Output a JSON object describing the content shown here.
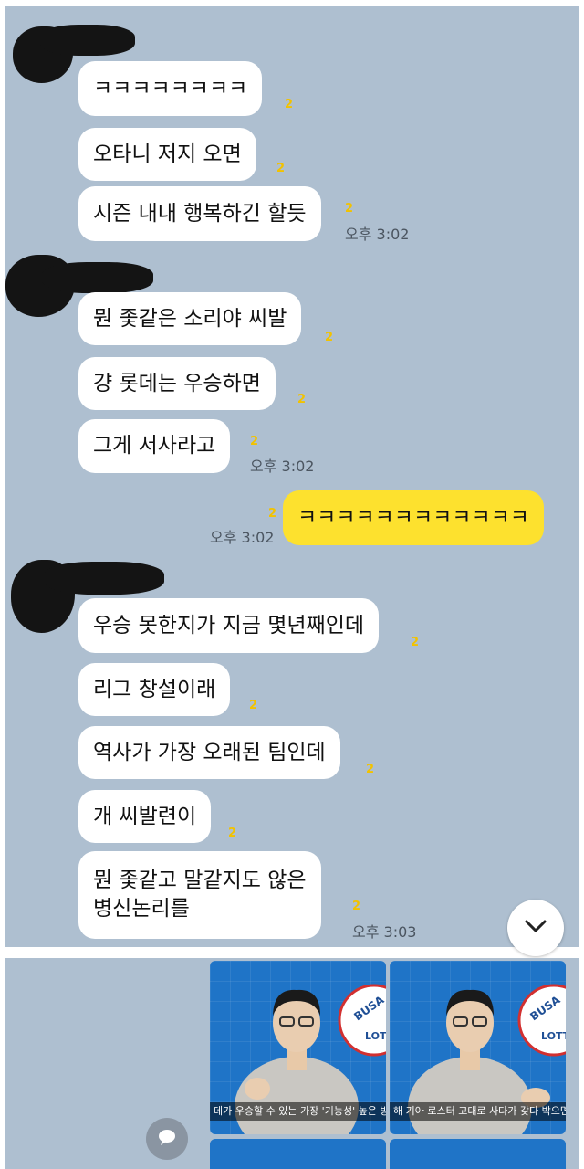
{
  "messages": [
    {
      "text": "ㅋㅋㅋㅋㅋㅋㅋㅋ",
      "unread": "2"
    },
    {
      "text": "오타니 저지 오면",
      "unread": "2"
    },
    {
      "text": "시즌 내내 행복하긴 할듯",
      "unread": "2",
      "time": "오후 3:02"
    },
    {
      "text": "뭔 좇같은 소리야 씨발",
      "unread": "2"
    },
    {
      "text": "걍 롯데는 우승하면",
      "unread": "2"
    },
    {
      "text": "그게 서사라고",
      "unread": "2",
      "time": "오후 3:02"
    },
    {
      "text": "ㅋㅋㅋㅋㅋㅋㅋㅋㅋㅋㅋㅋ",
      "unread": "2",
      "time": "오후 3:02",
      "mine": true
    },
    {
      "text": "우승 못한지가 지금 몇년째인데",
      "unread": "2"
    },
    {
      "text": "리그 창설이래",
      "unread": "2"
    },
    {
      "text": "역사가 가장 오래된 팀인데",
      "unread": "2"
    },
    {
      "text": "개 씨발련이",
      "unread": "2"
    },
    {
      "lines": [
        "뭔 좇같고 말같지도 않은",
        "병신논리를"
      ],
      "unread": "2",
      "time": "오후 3:03"
    }
  ],
  "media": {
    "thumbs": [
      {
        "caption": "데가 우승할 수 있는 가장 '기능성' 높은 방법이 뭐",
        "logo_text": "BUSA",
        "logo_text2": "LOTT"
      },
      {
        "caption": "해 기아 로스터 고대로 사다가 갖다 박으면 되잖아",
        "logo_text": "BUSA",
        "logo_text2": "LOTT"
      }
    ]
  },
  "icons": {
    "scroll_down": "chevron-down-icon",
    "chat": "chat-bubble-icon"
  },
  "colors": {
    "chat_bg": "#aebfd0",
    "my_bubble": "#fde12e",
    "other_bubble": "#ffffff",
    "unread": "#f2c200"
  }
}
